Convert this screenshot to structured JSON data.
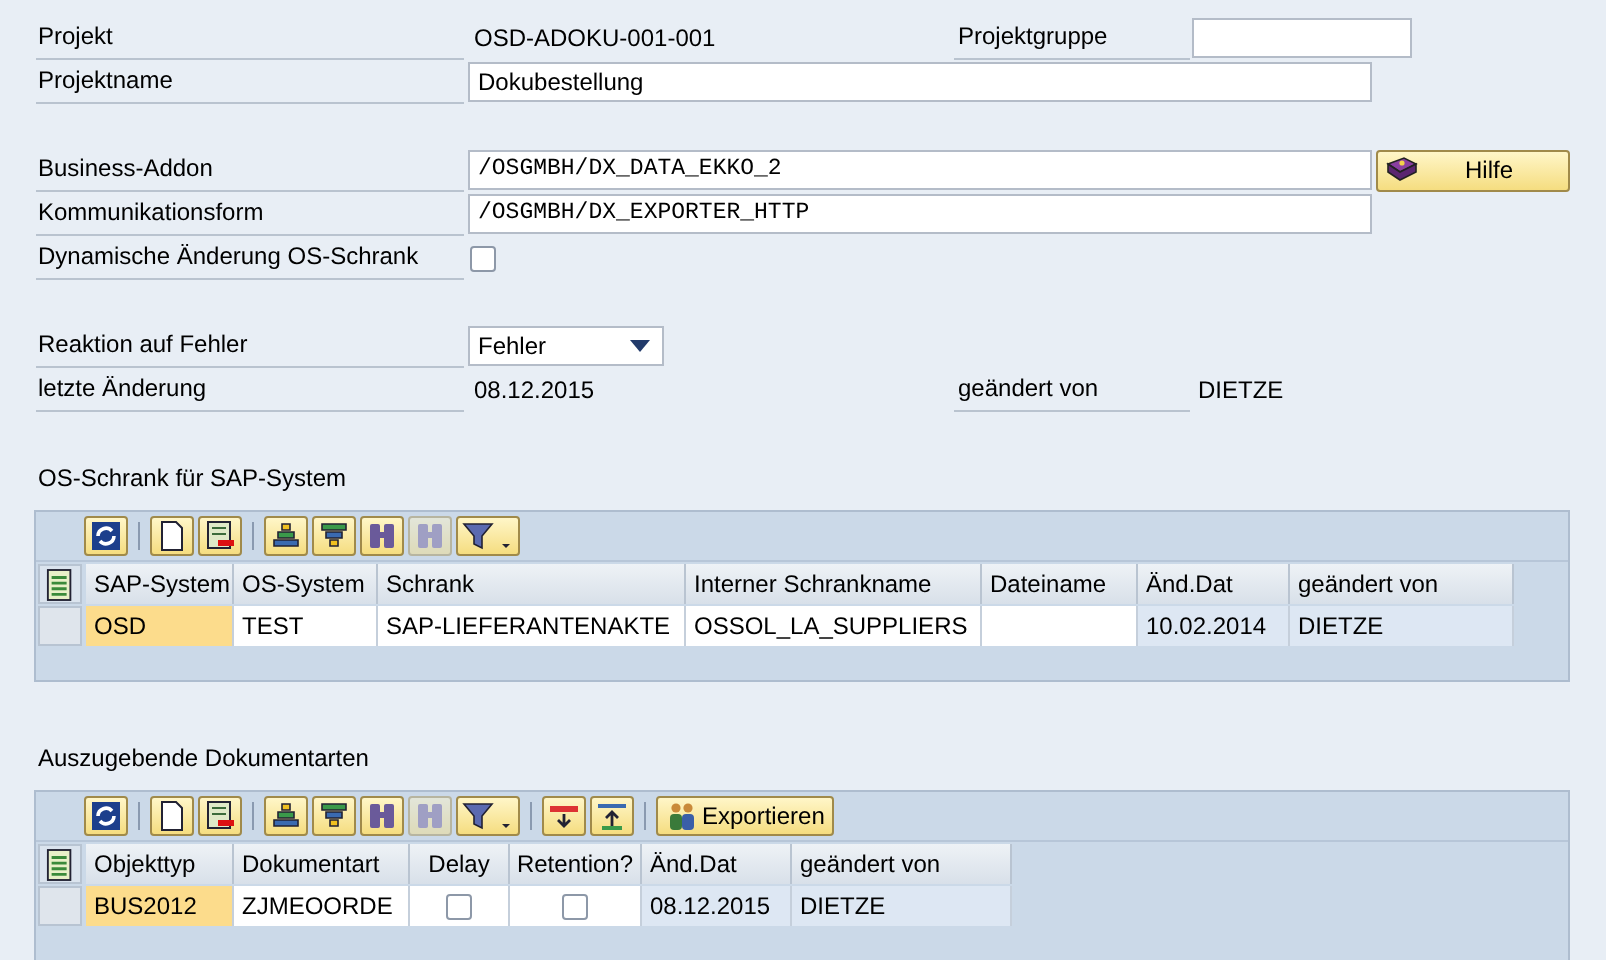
{
  "form": [
    {
      "label": "Projekt",
      "kind": "display",
      "value": "OSD-ADOKU-001-001",
      "side": {
        "label": "Projektgruppe",
        "kind": "input"
      }
    },
    {
      "label": "Projektname",
      "kind": "input",
      "value": "Dokubestellung"
    },
    {
      "label": "Business-Addon",
      "kind": "input",
      "mono": true,
      "value": "/OSGMBH/DX_DATA_EKKO_2",
      "button": "Hilfe",
      "gap_before": true
    },
    {
      "label": "Kommunikationsform",
      "kind": "input",
      "mono": true,
      "value": "/OSGMBH/DX_EXPORTER_HTTP"
    },
    {
      "label": "Dynamische Änderung OS-Schrank",
      "kind": "checkbox",
      "checked": false
    },
    {
      "label": "Reaktion auf Fehler",
      "kind": "dropdown",
      "value": "Fehler",
      "gap_before": true
    },
    {
      "label": "letzte Änderung",
      "kind": "display",
      "value": "08.12.2015",
      "side": {
        "label": "geändert von",
        "kind": "display",
        "value": "DIETZE"
      }
    }
  ],
  "grids": [
    {
      "title": "OS-Schrank für SAP-System",
      "toolbar": [
        {
          "kind": "refresh",
          "disabled": false
        },
        {
          "kind": "sep"
        },
        {
          "kind": "new",
          "disabled": false
        },
        {
          "kind": "delete",
          "disabled": false
        },
        {
          "kind": "sep"
        },
        {
          "kind": "sort-up",
          "disabled": false
        },
        {
          "kind": "sort-down",
          "disabled": false
        },
        {
          "kind": "find",
          "disabled": false
        },
        {
          "kind": "find-next",
          "disabled": true
        },
        {
          "kind": "filter",
          "disabled": false
        }
      ],
      "columns": [
        {
          "label": "SAP-System",
          "kind": "key"
        },
        {
          "label": "OS-System",
          "kind": "input"
        },
        {
          "label": "Schrank",
          "kind": "input"
        },
        {
          "label": "Interner Schrankname",
          "kind": "input"
        },
        {
          "label": "Dateiname",
          "kind": "input"
        },
        {
          "label": "Änd.Dat",
          "kind": "display"
        },
        {
          "label": "geändert von",
          "kind": "display"
        }
      ],
      "rows": [
        {
          "cells": [
            "OSD",
            "TEST",
            "SAP-LIEFERANTENAKTE",
            "OSSOL_LA_SUPPLIERS",
            "",
            "10.02.2014",
            "DIETZE"
          ]
        }
      ]
    },
    {
      "title": "Auszugebende Dokumentarten",
      "toolbar": [
        {
          "kind": "refresh",
          "disabled": false
        },
        {
          "kind": "sep"
        },
        {
          "kind": "new",
          "disabled": false
        },
        {
          "kind": "delete",
          "disabled": false
        },
        {
          "kind": "sep"
        },
        {
          "kind": "sort-up",
          "disabled": false
        },
        {
          "kind": "sort-down",
          "disabled": false
        },
        {
          "kind": "find",
          "disabled": false
        },
        {
          "kind": "find-next",
          "disabled": true
        },
        {
          "kind": "filter",
          "disabled": false
        },
        {
          "kind": "sep"
        },
        {
          "kind": "download",
          "disabled": false
        },
        {
          "kind": "upload",
          "disabled": false
        },
        {
          "kind": "sep"
        },
        {
          "kind": "text",
          "label": "Exportieren",
          "disabled": false
        }
      ],
      "columns": [
        {
          "label": "Objekttyp",
          "kind": "key"
        },
        {
          "label": "Dokumentart",
          "kind": "input"
        },
        {
          "label": "Delay",
          "kind": "checkbox"
        },
        {
          "label": "Retention?",
          "kind": "checkbox"
        },
        {
          "label": "Änd.Dat",
          "kind": "display"
        },
        {
          "label": "geändert von",
          "kind": "display"
        }
      ],
      "rows": [
        {
          "cells": [
            "BUS2012",
            "ZJMEOORDE",
            false,
            false,
            "08.12.2015",
            "DIETZE"
          ]
        }
      ]
    }
  ]
}
